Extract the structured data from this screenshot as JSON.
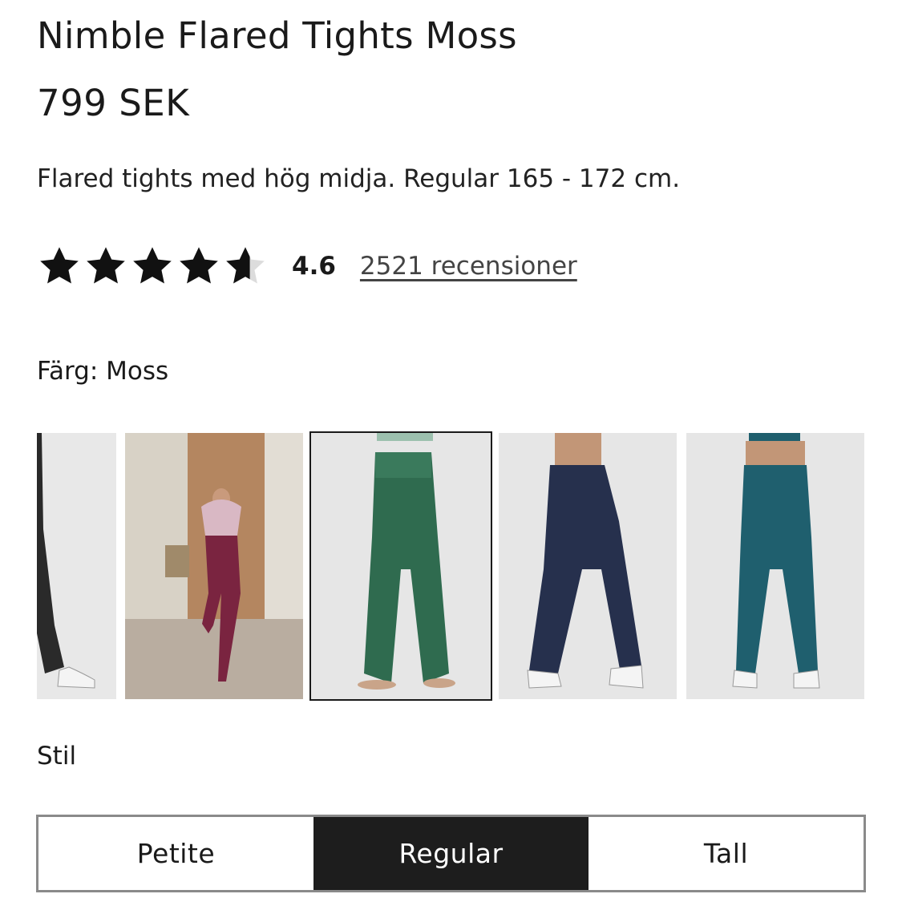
{
  "product": {
    "title": "Nimble Flared Tights Moss",
    "price": "799 SEK",
    "description": "Flared tights med hög midja. Regular 165 - 172 cm."
  },
  "rating": {
    "value": "4.6",
    "value_numeric": 4.6,
    "max": 5,
    "reviews_text": "2521 recensioner",
    "star_color": "#111111",
    "empty_star_color": "#d9d9d9"
  },
  "color": {
    "label": "Färg: Moss",
    "swatches": [
      {
        "name": "black",
        "color": "#2a2a2a",
        "selected": false
      },
      {
        "name": "burgundy-lifestyle",
        "color": "#7a2440",
        "selected": false
      },
      {
        "name": "moss",
        "color": "#2f6b4f",
        "selected": true
      },
      {
        "name": "navy",
        "color": "#26304d",
        "selected": false
      },
      {
        "name": "teal",
        "color": "#1f5f6e",
        "selected": false
      }
    ]
  },
  "style": {
    "label": "Stil",
    "options": [
      "Petite",
      "Regular",
      "Tall"
    ],
    "selected": "Regular"
  }
}
